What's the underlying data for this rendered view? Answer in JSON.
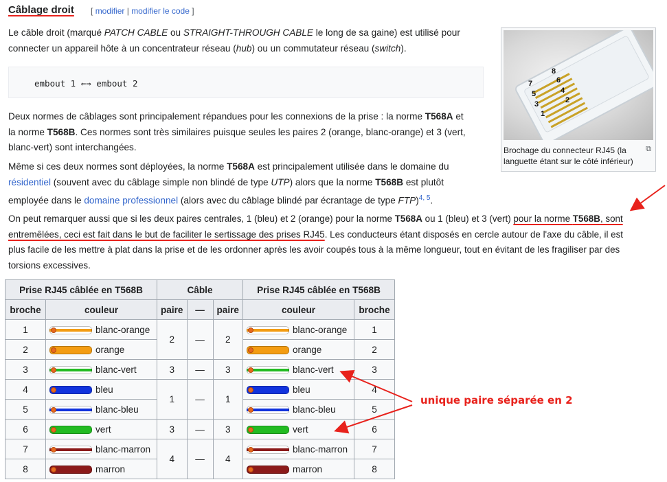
{
  "section": {
    "title": "Câblage droit",
    "edit_open": "[",
    "edit_modifier": "modifier",
    "edit_sep": "|",
    "edit_code": "modifier le code",
    "edit_close": "]"
  },
  "p1": {
    "a": "Le câble droit (marqué ",
    "b": "PATCH CABLE",
    "c": " ou ",
    "d": "STRAIGHT-THROUGH CABLE",
    "e": " le long de sa gaine) est utilisé pour",
    "f": "connecter un appareil hôte à un concentrateur réseau (",
    "g": "hub",
    "h": ") ou un commutateur réseau (",
    "i": "switch",
    "j": ")."
  },
  "code": "embout 1 ⇐⇒ embout 2",
  "p2": {
    "a": "Deux normes de câblages sont principalement répandues pour les connexions de la prise : la norme ",
    "b": "T568A",
    "c": " et",
    "d": "la norme ",
    "e": "T568B",
    "f": ". Ces normes sont très similaires puisque seules les paires 2 (orange, blanc-orange) et 3 (vert,",
    "g": "blanc-vert) sont interchangées."
  },
  "p3": {
    "a": "Même si ces deux normes sont déployées, la norme ",
    "b": "T568A",
    "c": " est principalement utilisée dans le domaine du",
    "d": "résidentiel",
    "e": " (souvent avec du câblage simple non blindé de type ",
    "f": "UTP",
    "g": ") alors que la norme ",
    "h": "T568B",
    "i": " est plutôt",
    "j": "employée dans le ",
    "k": "domaine professionnel",
    "l": " (alors avec du câblage blindé par écrantage de type ",
    "m": "FTP",
    "n": ")",
    "sup": "4, 5",
    "o": "."
  },
  "p4": {
    "a": "On peut remarquer aussi que si les deux paires centrales, 1 (bleu) et 2 (orange) pour la norme ",
    "b": "T568A",
    "c": " ou 1 (bleu) et 3 (vert) ",
    "d": "pour la norme ",
    "e": "T568B",
    "f": ", sont",
    "g": "entremêlées, ceci est fait dans le but de faciliter le sertissage des prises RJ45",
    "h": ". Les conducteurs étant disposés en cercle autour de l'axe du câble, il est",
    "i": "plus facile de les mettre à plat dans la prise et de les ordonner après les avoir coupés tous à la même longueur, tout en évitant de les fragiliser par des",
    "j": "torsions excessives."
  },
  "figure": {
    "caption": "Brochage du connecteur RJ45 (la languette étant sur le côté inférieur)",
    "pins": [
      "1",
      "2",
      "3",
      "4",
      "5",
      "6",
      "7",
      "8"
    ],
    "enlarge_icon": "enlarge-icon"
  },
  "table": {
    "h_left": "Prise RJ45 câblée en T568B",
    "h_mid": "Câble",
    "h_right": "Prise RJ45 câblée en T568B",
    "sub": [
      "broche",
      "couleur",
      "paire",
      "—",
      "paire",
      "couleur",
      "broche"
    ],
    "rows": [
      {
        "pin": "1",
        "color": "blanc-orange",
        "pair": "2",
        "dash": "—",
        "swatch": "white-orange"
      },
      {
        "pin": "2",
        "color": "orange",
        "swatch": "orange"
      },
      {
        "pin": "3",
        "color": "blanc-vert",
        "pair": "3",
        "dash": "—",
        "swatch": "white-green"
      },
      {
        "pin": "4",
        "color": "bleu",
        "pair": "1",
        "dash": "—",
        "swatch": "blue"
      },
      {
        "pin": "5",
        "color": "blanc-bleu",
        "swatch": "white-blue"
      },
      {
        "pin": "6",
        "color": "vert",
        "pair": "3",
        "dash": "—",
        "swatch": "green"
      },
      {
        "pin": "7",
        "color": "blanc-marron",
        "pair": "4",
        "dash": "—",
        "swatch": "white-brown"
      },
      {
        "pin": "8",
        "color": "marron",
        "swatch": "brown"
      }
    ]
  },
  "annotation": "unique paire séparée en 2",
  "colors": {
    "link": "#3366cc",
    "annotation": "#e8221c",
    "orange": "#f39c12",
    "green": "#22bb22",
    "blue": "#1133dd",
    "brown": "#8b1a1a"
  }
}
